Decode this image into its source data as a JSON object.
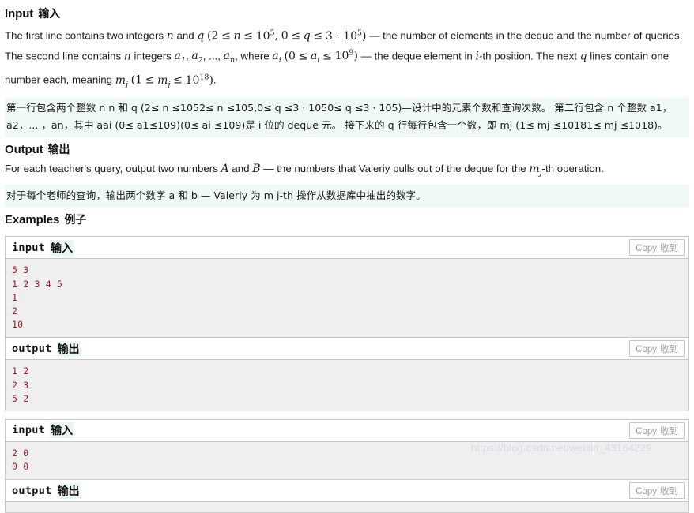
{
  "sections": {
    "input": {
      "heading_en": "Input",
      "heading_cn": "输入",
      "translation": "第一行包含两个整数 n n 和 q (2≤ n ≤1052≤ n ≤105,0≤ q ≤3 · 1050≤ q ≤3 · 105)—设计中的元素个数和查询次数。 第二行包含 n 个整数 a1，a2，... ，an，其中 aai (0≤ a1≤109)(0≤ ai ≤109)是 i 位的 deque 元。 接下来的 q 行每行包含一个数，即 mj (1≤ mj ≤10181≤ mj ≤1018)。"
    },
    "output": {
      "heading_en": "Output",
      "heading_cn": "输出",
      "translation": "对于每个老师的查询，输出两个数字 a 和 b — Valeriy 为 m j-th 操作从数据库中抽出的数字。"
    },
    "examples": {
      "heading_en": "Examples",
      "heading_cn": "例子"
    }
  },
  "labels": {
    "input_en": "input",
    "input_cn": "输入",
    "output_en": "output",
    "output_cn": "输出",
    "copy_en": "Copy",
    "copy_cn": "收到"
  },
  "examples": [
    {
      "input": "5 3\n1 2 3 4 5\n1\n2\n10",
      "output": "1 2\n2 3\n5 2"
    },
    {
      "input": "2 0\n0 0",
      "output": ""
    }
  ],
  "watermark": "https://blog.csdn.net/weixin_43164229",
  "colors": {
    "code_text": "#9b1f26",
    "code_bg": "#efefef",
    "translation_bg": "#eff9f6",
    "highlight_cn": "#eaf7ee",
    "border": "#c8c8c8"
  }
}
